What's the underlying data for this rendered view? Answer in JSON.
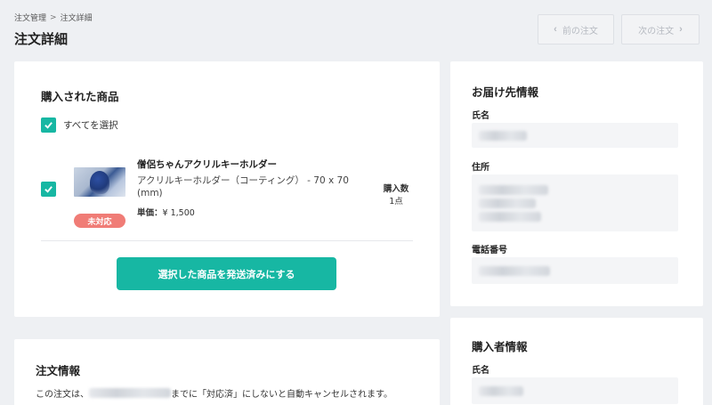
{
  "breadcrumb": {
    "parent": "注文管理",
    "separator": ">",
    "current": "注文詳細"
  },
  "page_title": "注文詳細",
  "nav": {
    "prev_label": "前の注文",
    "next_label": "次の注文"
  },
  "products": {
    "heading": "購入された商品",
    "select_all_label": "すべてを選択",
    "items": [
      {
        "name": "僧侶ちゃんアクリルキーホルダー",
        "variant": "アクリルキーホルダー（コーティング） - 70 x 70 (mm)",
        "price_label": "単価：",
        "price_value": "¥ 1,500",
        "status": "未対応",
        "qty_label": "購入数",
        "qty_value": "1点"
      }
    ],
    "ship_button_label": "選択した商品を発送済みにする"
  },
  "order_info": {
    "heading": "注文情報",
    "notice_prefix": "この注文は、",
    "notice_suffix": "までに「対応済」にしないと自動キャンセルされます。"
  },
  "shipping": {
    "heading": "お届け先情報",
    "name_label": "氏名",
    "address_label": "住所",
    "phone_label": "電話番号"
  },
  "buyer": {
    "heading": "購入者情報",
    "name_label": "氏名"
  },
  "colors": {
    "accent": "#17b7a3",
    "status_badge": "#f07c76",
    "background": "#eef0f3"
  }
}
